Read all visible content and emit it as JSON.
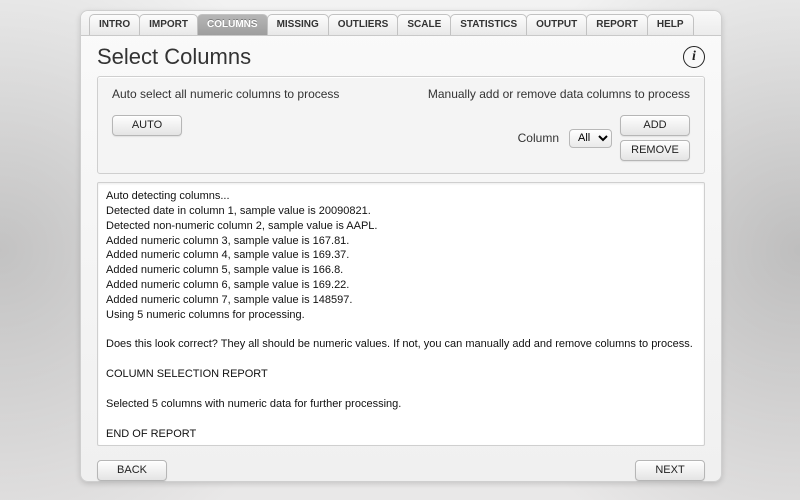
{
  "tabs": [
    {
      "label": "INTRO",
      "active": false
    },
    {
      "label": "IMPORT",
      "active": false
    },
    {
      "label": "COLUMNS",
      "active": true
    },
    {
      "label": "MISSING",
      "active": false
    },
    {
      "label": "OUTLIERS",
      "active": false
    },
    {
      "label": "SCALE",
      "active": false
    },
    {
      "label": "STATISTICS",
      "active": false
    },
    {
      "label": "OUTPUT",
      "active": false
    },
    {
      "label": "REPORT",
      "active": false
    },
    {
      "label": "HELP",
      "active": false
    }
  ],
  "heading": "Select Columns",
  "info_glyph": "i",
  "controls": {
    "left_label": "Auto select all numeric columns to process",
    "auto_button": "AUTO",
    "right_label": "Manually add or remove data columns to process",
    "column_label": "Column",
    "column_select": "All",
    "add_button": "ADD",
    "remove_button": "REMOVE"
  },
  "report_text": "Auto detecting columns...\nDetected date in column 1, sample value is 20090821.\nDetected non-numeric column 2, sample value is AAPL.\nAdded numeric column 3, sample value is 167.81.\nAdded numeric column 4, sample value is 169.37.\nAdded numeric column 5, sample value is 166.8.\nAdded numeric column 6, sample value is 169.22.\nAdded numeric column 7, sample value is 148597.\nUsing 5 numeric columns for processing.\n\nDoes this look correct? They all should be numeric values. If not, you can manually add and remove columns to process.\n\nCOLUMN SELECTION REPORT\n\nSelected 5 columns with numeric data for further processing.\n\nEND OF REPORT",
  "footer": {
    "back": "BACK",
    "next": "NEXT"
  }
}
